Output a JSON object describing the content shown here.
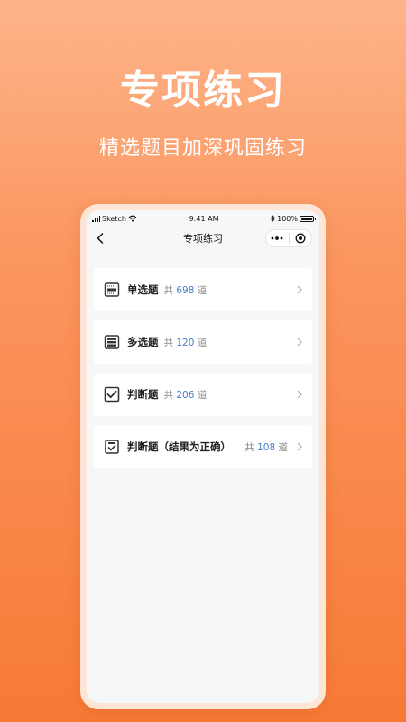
{
  "hero": {
    "title": "专项练习",
    "subtitle": "精选题目加深巩固练习"
  },
  "status_bar": {
    "carrier": "Sketch",
    "time": "9:41 AM",
    "battery": "100%"
  },
  "nav": {
    "title": "专项练习"
  },
  "items": [
    {
      "name": "单选题",
      "prefix": "共",
      "count": "698",
      "suffix": "道",
      "icon": "single-choice-icon"
    },
    {
      "name": "多选题",
      "prefix": "共",
      "count": "120",
      "suffix": "道",
      "icon": "multiple-choice-icon"
    },
    {
      "name": "判断题",
      "prefix": "共",
      "count": "206",
      "suffix": "道",
      "icon": "checkbox-icon"
    },
    {
      "name": "判断题（结果为正确）",
      "prefix": "共",
      "count": "108",
      "suffix": "道",
      "icon": "clipboard-check-icon"
    }
  ],
  "colors": {
    "accent": "#f77a36",
    "count_blue": "#4a7cc9"
  }
}
